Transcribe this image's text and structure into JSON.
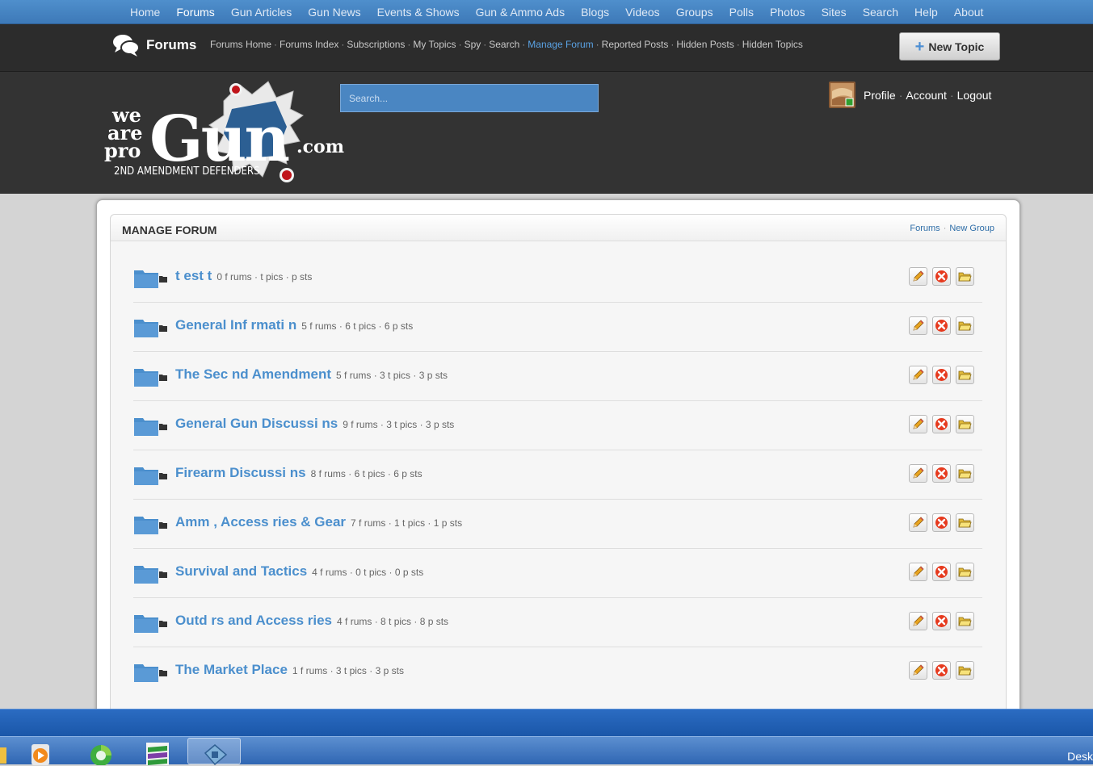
{
  "topnav": {
    "items": [
      "Home",
      "Forums",
      "Gun Articles",
      "Gun News",
      "Events & Shows",
      "Gun & Ammo Ads",
      "Blogs",
      "Videos",
      "Groups",
      "Polls",
      "Photos",
      "Sites",
      "Search",
      "Help",
      "About"
    ],
    "active": "Forums"
  },
  "forumbar": {
    "title": "Forums",
    "links": [
      "Forums Home",
      "Forums Index",
      "Subscriptions",
      "My Topics",
      "Spy",
      "Search",
      "Manage Forum",
      "Reported Posts",
      "Hidden Posts",
      "Hidden Topics"
    ],
    "active": "Manage Forum",
    "new_topic_label": "New Topic"
  },
  "header": {
    "logo": {
      "line1": "we",
      "line2": "are",
      "line3": "pro",
      "big": "Gun",
      "dotcom": ".com",
      "tagline": "2ND AMENDMENT DEFENDERS"
    },
    "search_placeholder": "Search...",
    "user_links": [
      "Profile",
      "Account",
      "Logout"
    ]
  },
  "panel": {
    "title": "MANAGE FORUM",
    "links": [
      "Forums",
      "New Group"
    ]
  },
  "forums": [
    {
      "title": "t   est   t",
      "stats": "0 f   rums · t   pics · p   sts"
    },
    {
      "title": "General Inf   rmati   n",
      "stats": "5 f   rums · 6 t   pics · 6 p   sts"
    },
    {
      "title": "The Sec   nd Amendment",
      "stats": "5 f   rums · 3 t   pics · 3 p   sts"
    },
    {
      "title": "General Gun Discussi   ns",
      "stats": "9 f   rums · 3 t   pics · 3 p   sts"
    },
    {
      "title": "Firearm Discussi   ns",
      "stats": "8 f   rums · 6 t   pics · 6 p   sts"
    },
    {
      "title": "Amm   , Access   ries & Gear",
      "stats": "7 f   rums · 1 t   pics · 1 p   sts"
    },
    {
      "title": "Survival and Tactics",
      "stats": "4 f   rums · 0 t   pics · 0 p   sts"
    },
    {
      "title": "Outd      rs and Access   ries",
      "stats": "4 f   rums · 8 t   pics · 8 p   sts"
    },
    {
      "title": "The Market Place",
      "stats": "1 f   rums · 3 t   pics · 3 p   sts"
    }
  ],
  "row_action_icons": [
    "pencil-icon",
    "delete-icon",
    "folder-open-icon"
  ],
  "taskbar": {
    "desk_label": "Desk"
  },
  "colors": {
    "nav_blue": "#3d79b8",
    "link_blue": "#4b8fcd",
    "active_sub_link": "#5aa2e4",
    "dark_bar": "#2c2c2c",
    "header_bg": "#333333"
  }
}
